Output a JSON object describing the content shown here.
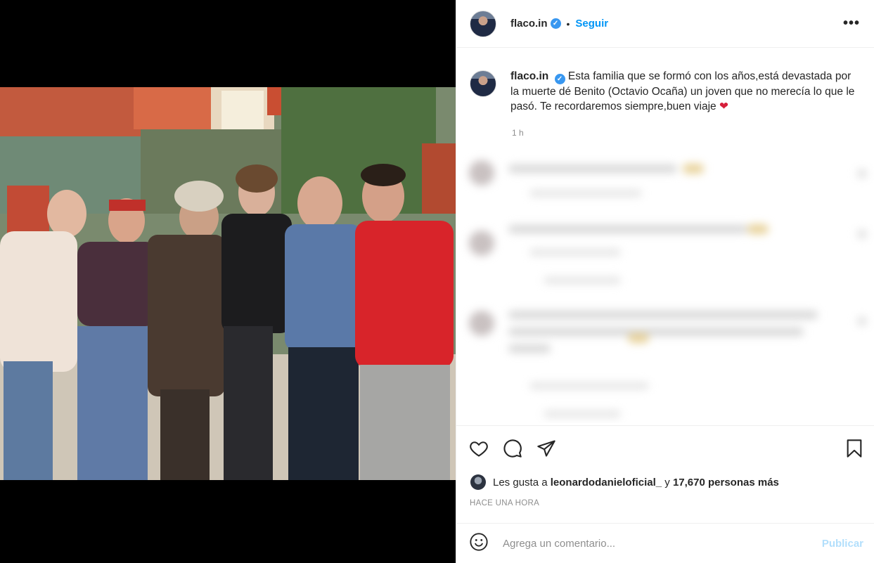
{
  "post": {
    "username": "flaco.in",
    "follow_label": "Seguir",
    "dot": "•",
    "more_label": "•••",
    "verified_mark": "✓"
  },
  "caption": {
    "username": "flaco.in",
    "text": "Esta familia que se formó con los años,está devastada por la muerte dé Benito (Octavio Ocaña) un joven que no merecía lo que le pasó. Te recordaremos siempre,buen viaje",
    "emoji": "❤",
    "time": "1 h"
  },
  "likes": {
    "prefix": "Les gusta a",
    "user": "leonardodanieloficial_",
    "connector": "y",
    "count_text": "17,670 personas más"
  },
  "timestamp": "HACE UNA HORA",
  "comment_box": {
    "placeholder": "Agrega un comentario...",
    "publish_label": "Publicar"
  },
  "colors": {
    "accent": "#0095f6",
    "publish_disabled": "#b2dffc",
    "verified": "#3897f0",
    "heart": "#d61f3b"
  },
  "icons": [
    "heart-icon",
    "comment-icon",
    "share-icon",
    "bookmark-icon",
    "emoji-icon",
    "more-icon",
    "verified-icon"
  ]
}
